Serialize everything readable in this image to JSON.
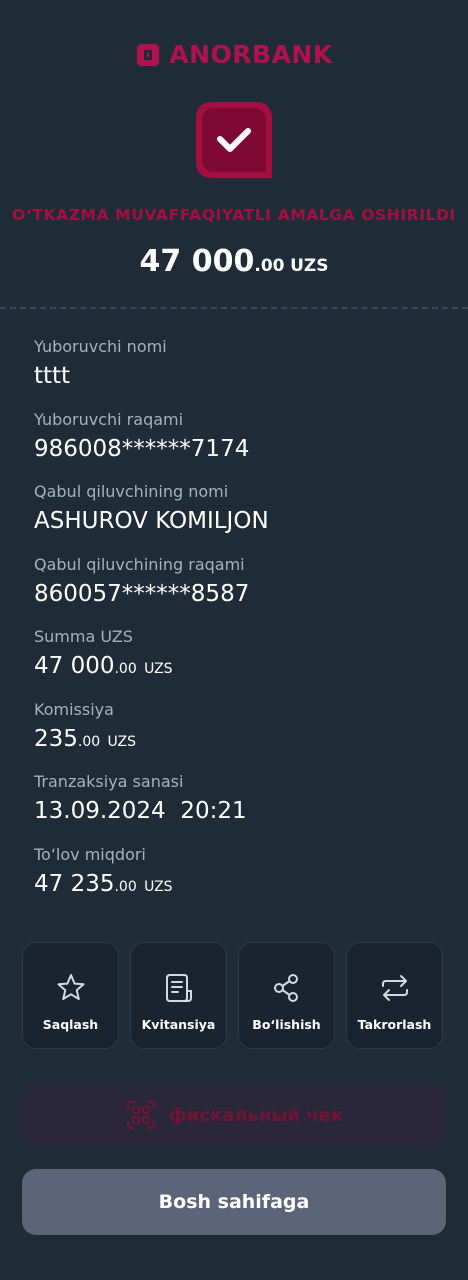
{
  "brand": {
    "name": "ANORBANK",
    "color": "#b0124e"
  },
  "status": {
    "title": "O‘TKAZMA MUVAFFAQIYATLI AMALGA OSHIRILDI",
    "icon": "check-icon",
    "color": "#a3103f"
  },
  "hero_amount": {
    "int": "47 000",
    "dec": ".00",
    "currency": "UZS"
  },
  "details": {
    "sender_name": {
      "label": "Yuboruvchi nomi",
      "value": "tttt"
    },
    "sender_number": {
      "label": "Yuboruvchi raqami",
      "value": "986008******7174"
    },
    "receiver_name": {
      "label": "Qabul qiluvchining nomi",
      "value": "ASHUROV KOMILJON"
    },
    "receiver_number": {
      "label": "Qabul qiluvchining raqami",
      "value": "860057******8587"
    },
    "amount": {
      "label": "Summa UZS",
      "int": "47 000",
      "dec": ".00",
      "currency": "UZS"
    },
    "commission": {
      "label": "Komissiya",
      "int": "235",
      "dec": ".00",
      "currency": "UZS"
    },
    "date": {
      "label": "Tranzaksiya sanasi",
      "value": "13.09.2024  20:21"
    },
    "total": {
      "label": "To‘lov miqdori",
      "int": "47 235",
      "dec": ".00",
      "currency": "UZS"
    }
  },
  "actions": [
    {
      "label": "Saqlash",
      "icon": "star-icon"
    },
    {
      "label": "Kvitansiya",
      "icon": "receipt-icon"
    },
    {
      "label": "Bo‘lishish",
      "icon": "share-icon"
    },
    {
      "label": "Takrorlash",
      "icon": "repeat-icon"
    }
  ],
  "fiscal": {
    "label": "фискальный чек",
    "icon": "qr-scan-icon"
  },
  "home_button": {
    "label": "Bosh sahifaga"
  }
}
